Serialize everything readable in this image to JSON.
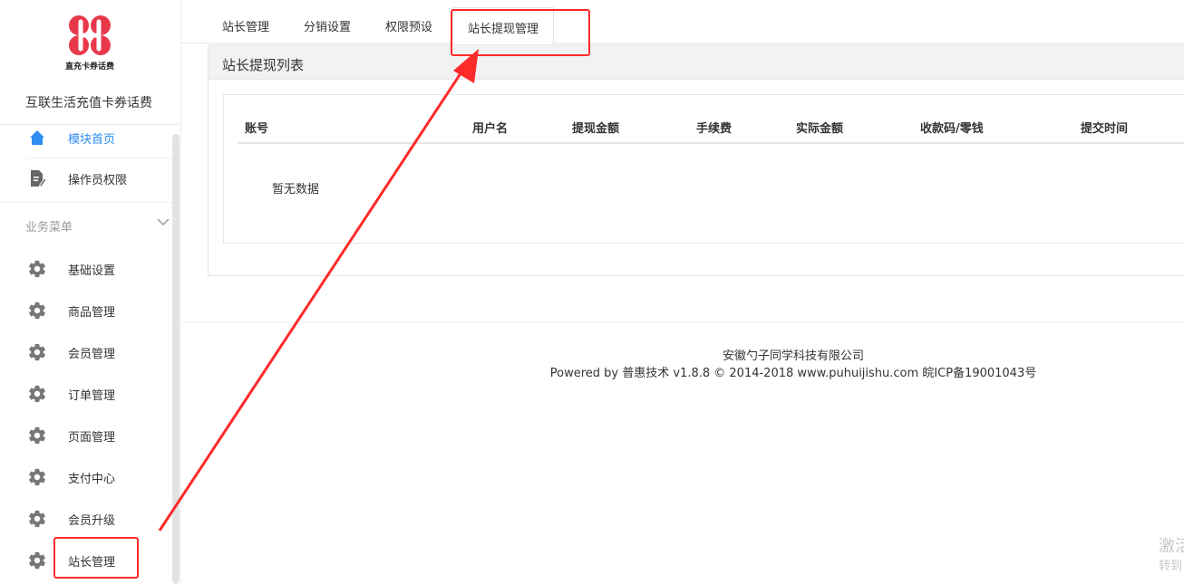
{
  "brand": {
    "logo_text": "直充卡券话费",
    "site_name": "互联生活充值卡券话费"
  },
  "sidebar": {
    "top_items": [
      {
        "label": "模块首页",
        "icon": "home-icon",
        "active": true
      },
      {
        "label": "操作员权限",
        "icon": "document-edit-icon",
        "active": false
      }
    ],
    "group_label": "业务菜单",
    "items": [
      {
        "label": "基础设置",
        "icon": "gear-icon"
      },
      {
        "label": "商品管理",
        "icon": "gear-icon"
      },
      {
        "label": "会员管理",
        "icon": "gear-icon"
      },
      {
        "label": "订单管理",
        "icon": "gear-icon"
      },
      {
        "label": "页面管理",
        "icon": "gear-icon"
      },
      {
        "label": "支付中心",
        "icon": "gear-icon"
      },
      {
        "label": "会员升级",
        "icon": "gear-icon"
      },
      {
        "label": "站长管理",
        "icon": "gear-icon"
      }
    ]
  },
  "tabs": [
    {
      "label": "站长管理"
    },
    {
      "label": "分销设置"
    },
    {
      "label": "权限预设"
    },
    {
      "label": "站长提现管理",
      "active": true
    }
  ],
  "panel": {
    "title": "站长提现列表",
    "columns": [
      "账号",
      "用户名",
      "提现金额",
      "手续费",
      "实际金额",
      "收款码/零钱",
      "提交时间"
    ],
    "empty_text": "暂无数据"
  },
  "footer": {
    "company": "安徽勺子同学科技有限公司",
    "powered": "Powered by 普惠技术 v1.8.8 © 2014-2018 www.puhuijishu.com 皖ICP备19001043号"
  },
  "watermark": {
    "line1": "激活",
    "line2": "转到"
  },
  "colors": {
    "accent": "#2d8cf0",
    "highlight": "#ff2a2a",
    "logo": "#e8394a"
  }
}
